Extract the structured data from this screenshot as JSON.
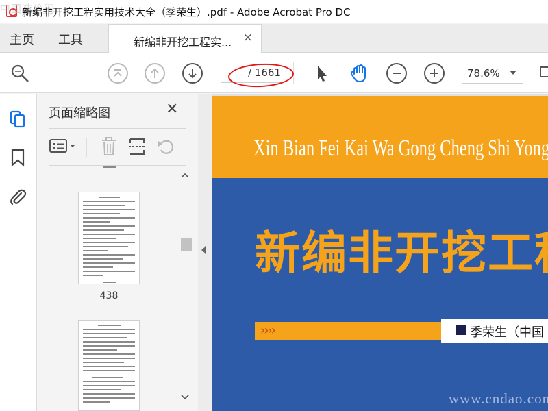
{
  "window": {
    "title": "新编非开挖工程实用技术大全（季荣生）.pdf - Adobe Acrobat Pro DC",
    "watermark_top_left": "中国造价网"
  },
  "nav": {
    "home_label": "主页",
    "tools_label": "工具"
  },
  "document_tab": {
    "label": "新编非开挖工程实...",
    "close_glyph": "×"
  },
  "toolbar": {
    "page_total": "/ 1661",
    "zoom": "78.6%"
  },
  "thumbnail_panel": {
    "title": "页面缩略图",
    "close_glyph": "✕",
    "items": [
      {
        "page_number": "438"
      }
    ]
  },
  "cover": {
    "pinyin": "Xin Bian Fei Kai Wa Gong Cheng Shi Yong Ji Shu",
    "title": "新编非开挖工程实用技术大全",
    "author_chevrons": "››››",
    "author": "季荣生（中国",
    "colors": {
      "blue": "#2d5ba8",
      "orange": "#f5a31a"
    }
  },
  "watermark_bottom_right": "www.cndao.com",
  "annotation": {
    "color": "#e01818"
  }
}
